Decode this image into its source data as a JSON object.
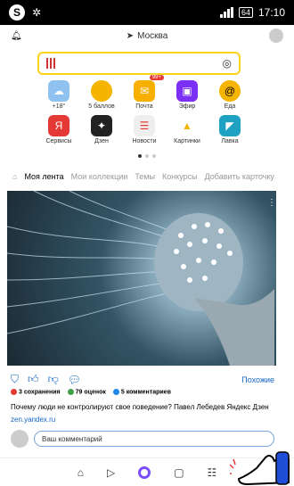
{
  "statusbar": {
    "battery": "64",
    "time": "17:10"
  },
  "top": {
    "location": "Москва"
  },
  "grid": [
    {
      "label": "+18°",
      "color": "#90c2f0",
      "icon": "cloud-icon"
    },
    {
      "label": "5 баллов",
      "color": "#f5b400",
      "icon": "traffic-icon"
    },
    {
      "label": "Почта",
      "color": "#f7b000",
      "icon": "mail-icon",
      "badge": "99+"
    },
    {
      "label": "Эфир",
      "color": "#7b2ff7",
      "icon": "tv-icon"
    },
    {
      "label": "Еда",
      "color": "#f5b400",
      "icon": "food-icon"
    },
    {
      "label": "Сервисы",
      "color": "#e53935",
      "icon": "yandex-icon"
    },
    {
      "label": "Дзен",
      "color": "#222222",
      "icon": "zen-icon"
    },
    {
      "label": "Новости",
      "color": "#e53935",
      "icon": "news-icon"
    },
    {
      "label": "Картинки",
      "color": "#f5b400",
      "icon": "images-icon"
    },
    {
      "label": "Лавка",
      "color": "#1fa2c2",
      "icon": "lavka-icon"
    }
  ],
  "tabs": [
    "Моя лента",
    "Мои коллекции",
    "Темы",
    "Конкурсы",
    "Добавить карточку"
  ],
  "post": {
    "similar": "Похожие",
    "saves": "3 сохранения",
    "ratings": "79 оценок",
    "comments": "5 комментариев",
    "caption": "Почему люди не контролируют свое поведение? Павел Лебедев Яндекс Дзен",
    "source": "zen.yandex.ru",
    "comment_placeholder": "Ваш комментарий"
  }
}
